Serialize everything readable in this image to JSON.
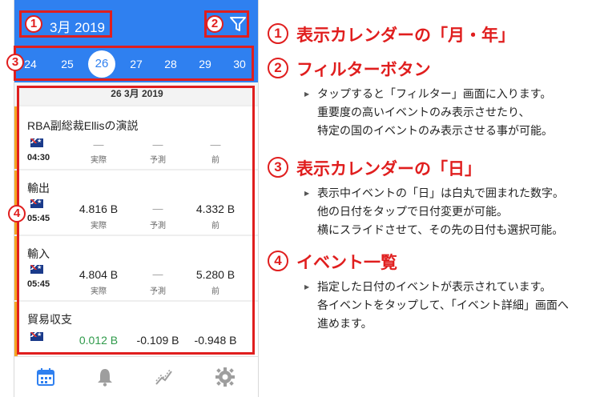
{
  "app": {
    "month_title": "3月 2019",
    "dates": [
      "24",
      "25",
      "26",
      "27",
      "28",
      "29",
      "30"
    ],
    "selected_date": "26",
    "day_header": "26 3月 2019",
    "labels": {
      "actual": "実際",
      "forecast": "予測",
      "previous": "前"
    },
    "events": [
      {
        "title": "RBA副総裁Ellisの演説",
        "time": "04:30",
        "actual": "―",
        "forecast": "―",
        "previous": "―"
      },
      {
        "title": "輸出",
        "time": "05:45",
        "actual": "4.816 B",
        "forecast": "―",
        "previous": "4.332 B"
      },
      {
        "title": "輸入",
        "time": "05:45",
        "actual": "4.804 B",
        "forecast": "―",
        "previous": "5.280 B"
      },
      {
        "title": "貿易収支",
        "time": "",
        "actual": "0.012 B",
        "forecast": "-0.109 B",
        "previous": "-0.948 B"
      }
    ],
    "nav": [
      "calendar-icon",
      "bell-icon",
      "chart-icon",
      "gear-icon"
    ],
    "accent": "#2f80f0",
    "highlight": "#e01e1e"
  },
  "markers": [
    "1",
    "2",
    "3",
    "4"
  ],
  "annotations": [
    {
      "num": "1",
      "title": "表示カレンダーの「月・年」",
      "lines": []
    },
    {
      "num": "2",
      "title": "フィルターボタン",
      "lines": [
        "タップすると「フィルター」画面に入ります。",
        "重要度の高いイベントのみ表示させたり、",
        "特定の国のイベントのみ表示させる事が可能。"
      ]
    },
    {
      "num": "3",
      "title": "表示カレンダーの「日」",
      "lines": [
        "表示中イベントの「日」は白丸で囲まれた数字。",
        "他の日付をタップで日付変更が可能。",
        "横にスライドさせて、その先の日付も選択可能。"
      ]
    },
    {
      "num": "4",
      "title": "イベント一覧",
      "lines": [
        "指定した日付のイベントが表示されています。",
        "各イベントをタップして、「イベント詳細」画面へ",
        "進めます。"
      ]
    }
  ]
}
